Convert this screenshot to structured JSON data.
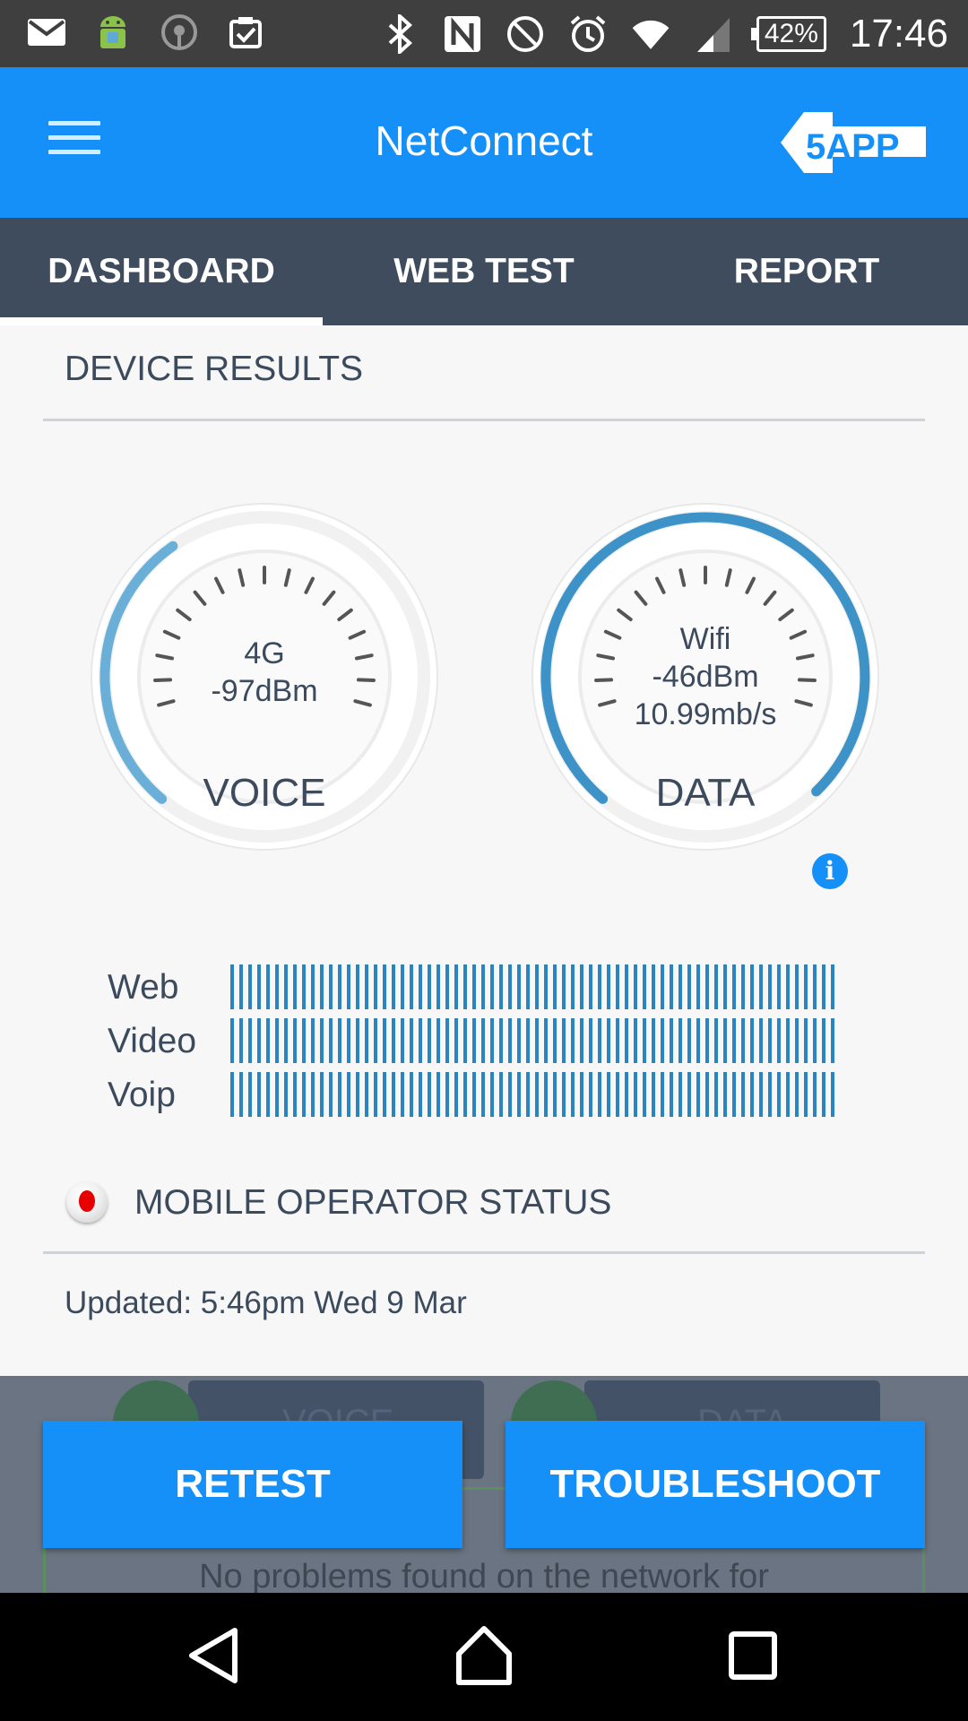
{
  "status_bar": {
    "icons": [
      "mail-icon",
      "android-icon",
      "hearing-icon",
      "clipboard-check-icon",
      "bluetooth-icon",
      "nfc-icon",
      "do-not-disturb-icon",
      "alarm-icon",
      "wifi-icon",
      "cell-signal-icon"
    ],
    "battery": "42%",
    "time": "17:46"
  },
  "appbar": {
    "title": "NetConnect",
    "logo_text": "5APP"
  },
  "tabs": [
    {
      "label": "DASHBOARD",
      "active": true
    },
    {
      "label": "WEB TEST",
      "active": false
    },
    {
      "label": "REPORT",
      "active": false
    }
  ],
  "device_results": {
    "title": "DEVICE RESULTS",
    "voice": {
      "line1": "4G",
      "line2": "-97dBm",
      "label": "VOICE"
    },
    "data": {
      "line1": "Wifi",
      "line2": "-46dBm",
      "line3": "10.99mb/s",
      "label": "DATA"
    }
  },
  "quality": {
    "rows": [
      {
        "label": "Web"
      },
      {
        "label": "Video"
      },
      {
        "label": "Voip"
      }
    ]
  },
  "operator": {
    "title": "MOBILE OPERATOR STATUS",
    "updated": "Updated: 5:46pm Wed 9 Mar"
  },
  "background_cards": {
    "voice_label": "VOICE",
    "data_label": "DATA",
    "message": "No problems found on the network for"
  },
  "actions": {
    "retest": "RETEST",
    "troubleshoot": "TROUBLESHOOT"
  },
  "colors": {
    "primary": "#1590f8",
    "tab_bar": "#3e4c5e",
    "gauge_arc": "#4aa0d0"
  }
}
